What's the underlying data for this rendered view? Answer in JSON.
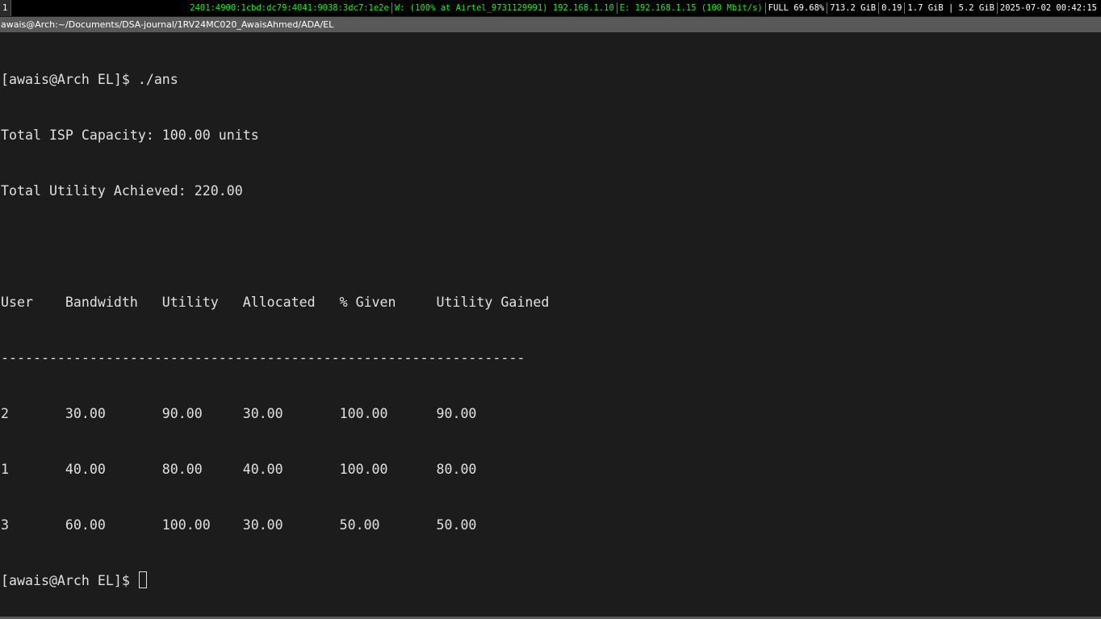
{
  "status_bar": {
    "workspace": "1",
    "ipv6": "2401:4900:1cbd:dc79:4041:9038:3dc7:1e2e",
    "wireless": "W: (100% at Airtel_9731129991) 192.168.1.10",
    "ethernet": "E: 192.168.1.15 (100 Mbit/s)",
    "battery": "FULL 69.68%",
    "disk": "713.2 GiB",
    "load": "0.19",
    "memory": "1.7 GiB | 5.2 GiB",
    "datetime": "2025-07-02 00:42:15",
    "accent_color": "#00ff00"
  },
  "window": {
    "title": "awais@Arch:~/Documents/DSA-journal/1RV24MC020_AwaisAhmed/ADA/EL"
  },
  "terminal": {
    "lines": [
      "[awais@Arch EL]$ ./ans",
      "Total ISP Capacity: 100.00 units",
      "Total Utility Achieved: 220.00",
      "",
      "User    Bandwidth   Utility   Allocated   % Given     Utility Gained",
      "-----------------------------------------------------------------",
      "2       30.00       90.00     30.00       100.00      90.00",
      "1       40.00       80.00     40.00       100.00      80.00",
      "3       60.00       100.00    30.00       50.00       50.00"
    ],
    "prompt": "[awais@Arch EL]$ "
  }
}
